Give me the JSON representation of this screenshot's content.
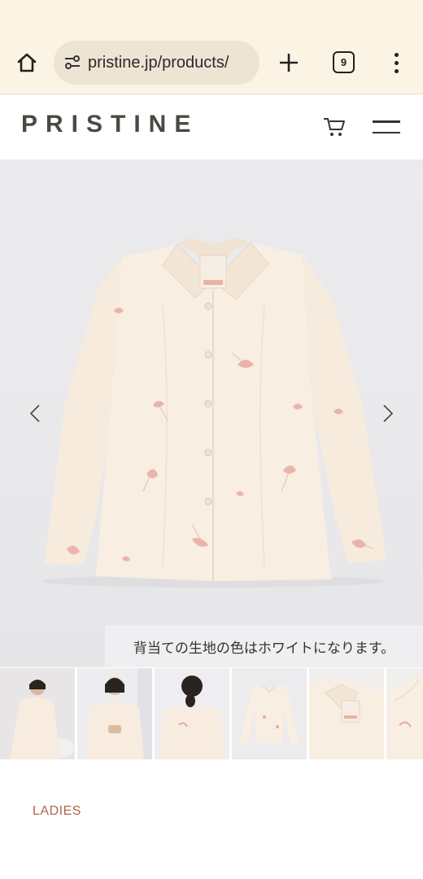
{
  "browser": {
    "url": "pristine.jp/products/",
    "tab_count": "9"
  },
  "header": {
    "logo": "PRISTINE"
  },
  "gallery": {
    "caption": "背当ての生地の色はホワイトになります。",
    "thumbnails": [
      {
        "selected": false
      },
      {
        "selected": false
      },
      {
        "selected": false
      },
      {
        "selected": true
      },
      {
        "selected": false
      },
      {
        "selected": false
      }
    ]
  },
  "product": {
    "category": "LADIES"
  },
  "colors": {
    "browser_bg": "#fbf3e4",
    "url_pill": "#ede4d4",
    "logo": "#4a4a42",
    "category": "#b0654a",
    "shirt": "#f8ede0",
    "print": "#e9a9a2"
  }
}
